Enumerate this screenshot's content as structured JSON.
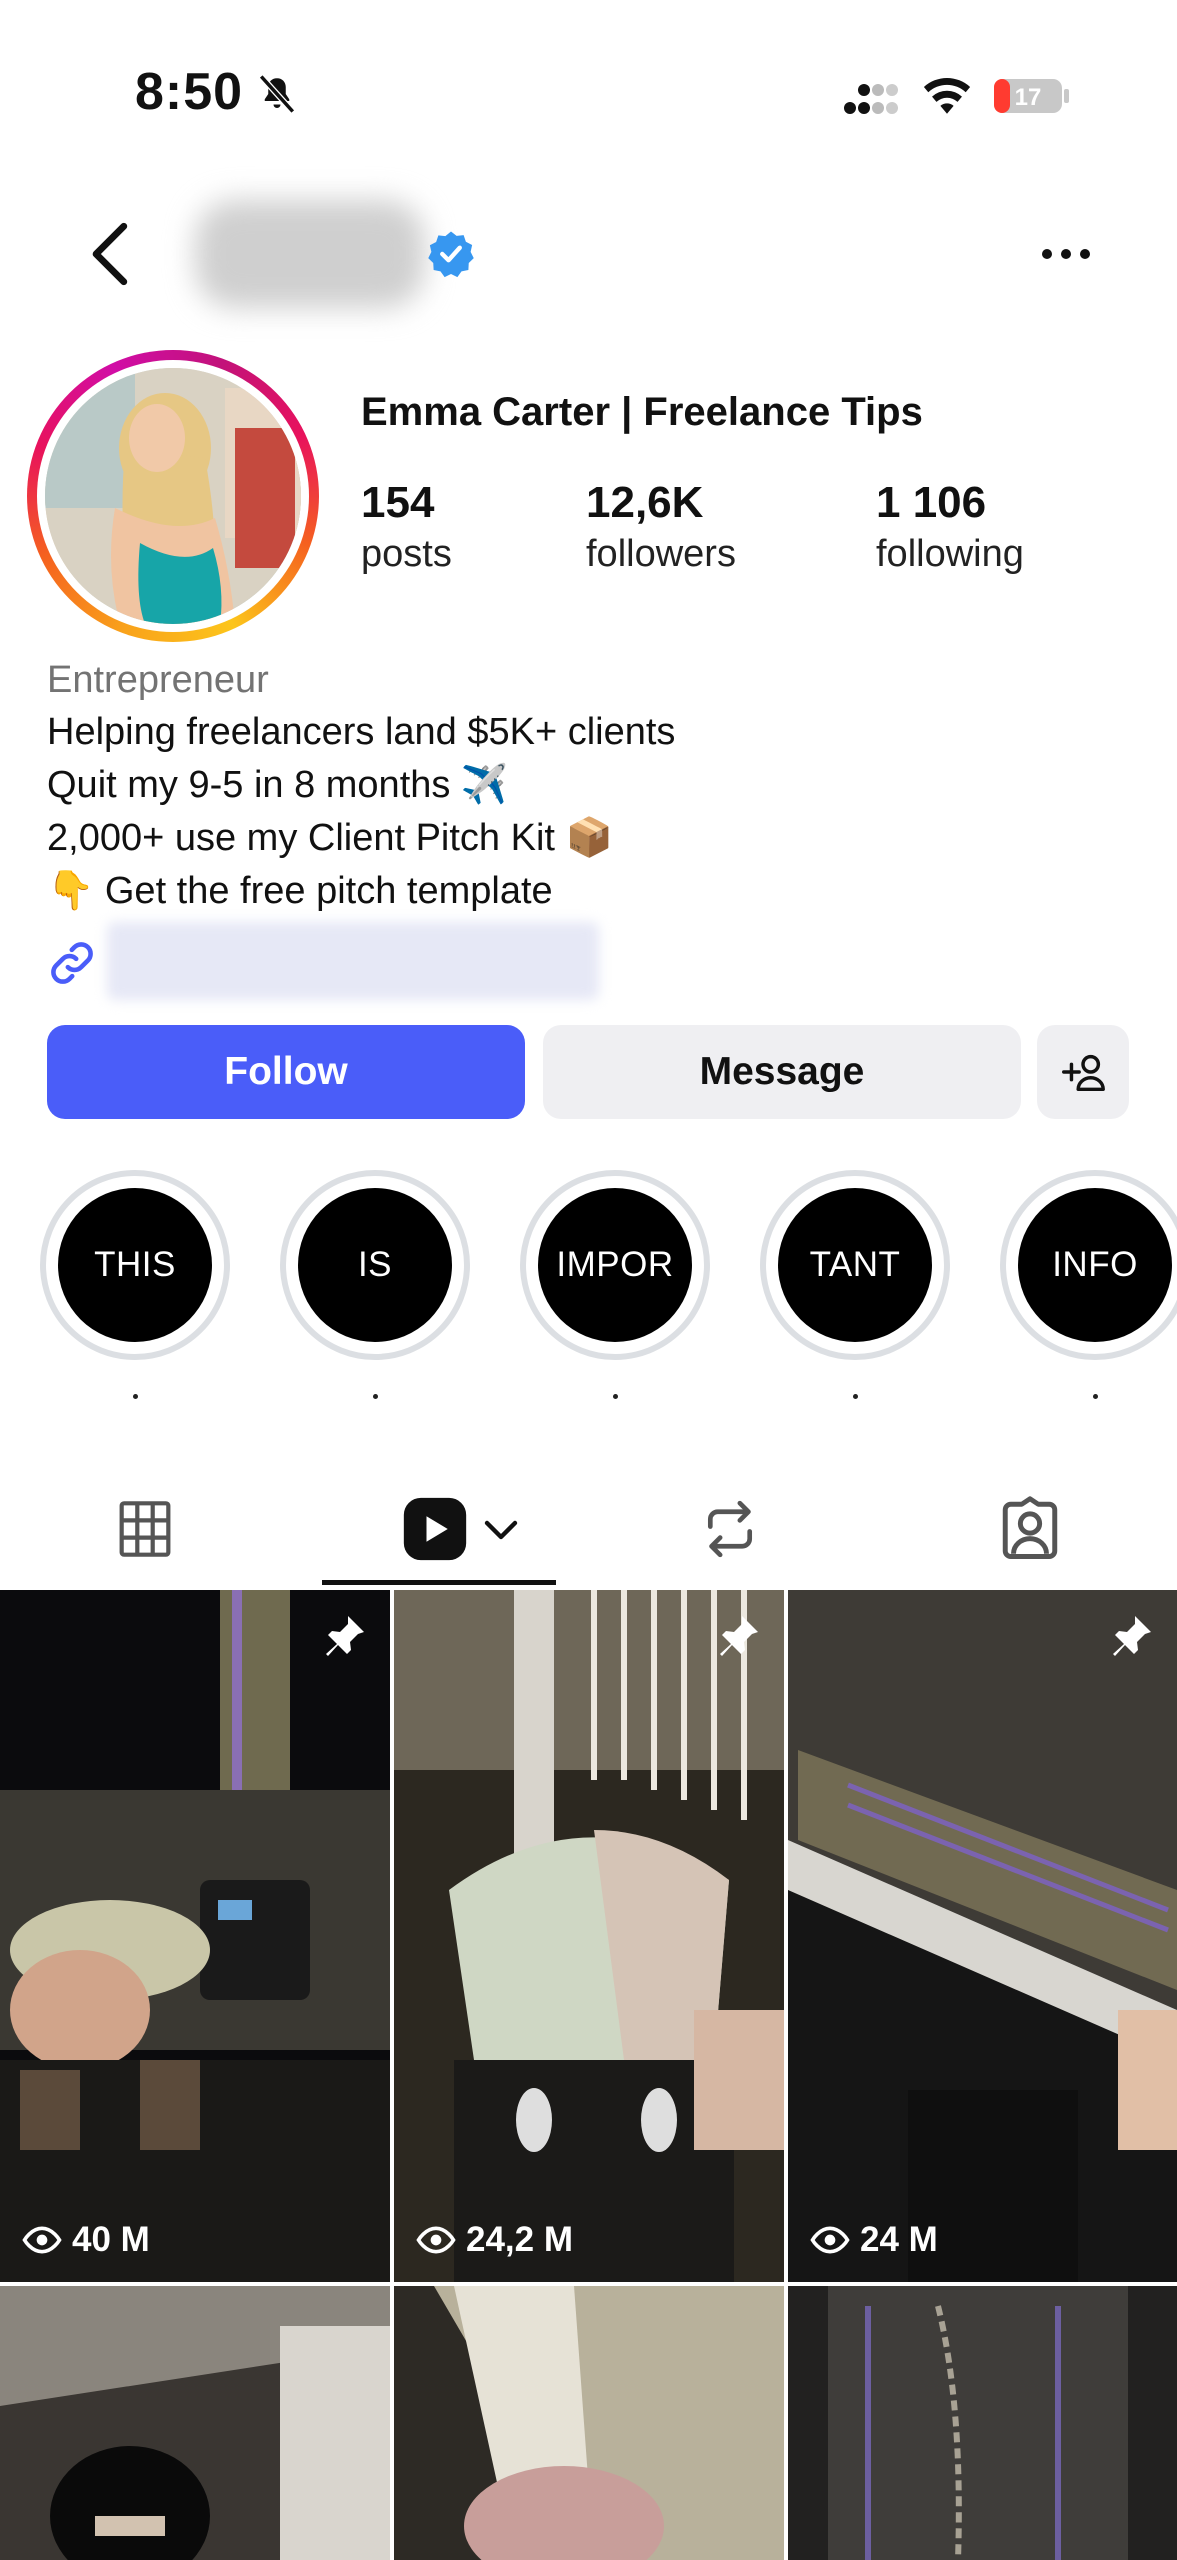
{
  "status_bar": {
    "time": "8:50",
    "battery": "17",
    "icons": [
      "bell-off-icon",
      "cellular-icon",
      "wifi-icon",
      "battery-icon"
    ]
  },
  "header": {
    "username": "",
    "verified": true,
    "icons": [
      "back-arrow-icon",
      "verified-badge-icon",
      "more-icon"
    ]
  },
  "profile": {
    "display_name": "Emma Carter | Freelance Tips",
    "stats": [
      {
        "value": "154",
        "label": "posts"
      },
      {
        "value": "12,6K",
        "label": "followers"
      },
      {
        "value": "1 106",
        "label": "following"
      }
    ],
    "category": "Entrepreneur",
    "bio_lines": [
      "Helping freelancers land $5K+ clients",
      "Quit my 9-5 in 8 months ✈️",
      "2,000+ use my Client Pitch Kit 📦",
      "👇 Get the free pitch template"
    ],
    "link": ""
  },
  "actions": {
    "follow": "Follow",
    "message": "Message"
  },
  "highlights": [
    {
      "label": "THIS",
      "caption": "."
    },
    {
      "label": "IS",
      "caption": "."
    },
    {
      "label": "IMPOR",
      "caption": "."
    },
    {
      "label": "TANT",
      "caption": "."
    },
    {
      "label": "INFO",
      "caption": "."
    }
  ],
  "tabs": [
    {
      "name": "posts-grid",
      "icon": "grid-icon"
    },
    {
      "name": "reels",
      "icon": "reels-icon",
      "active": true
    },
    {
      "name": "reposts",
      "icon": "repost-icon"
    },
    {
      "name": "tagged",
      "icon": "tagged-icon"
    }
  ],
  "grid": [
    {
      "views": "40 M",
      "pinned": true
    },
    {
      "views": "24,2 M",
      "pinned": true
    },
    {
      "views": "24 M",
      "pinned": true
    },
    {
      "views": "",
      "pinned": false
    },
    {
      "views": "",
      "pinned": false
    },
    {
      "views": "",
      "pinned": false
    }
  ],
  "colors": {
    "follow_button": "#4a5df9",
    "secondary_button": "#efeff2",
    "verified_badge": "#3797f0",
    "link_icon": "#4a5df9",
    "battery_low": "#ff3b30"
  }
}
